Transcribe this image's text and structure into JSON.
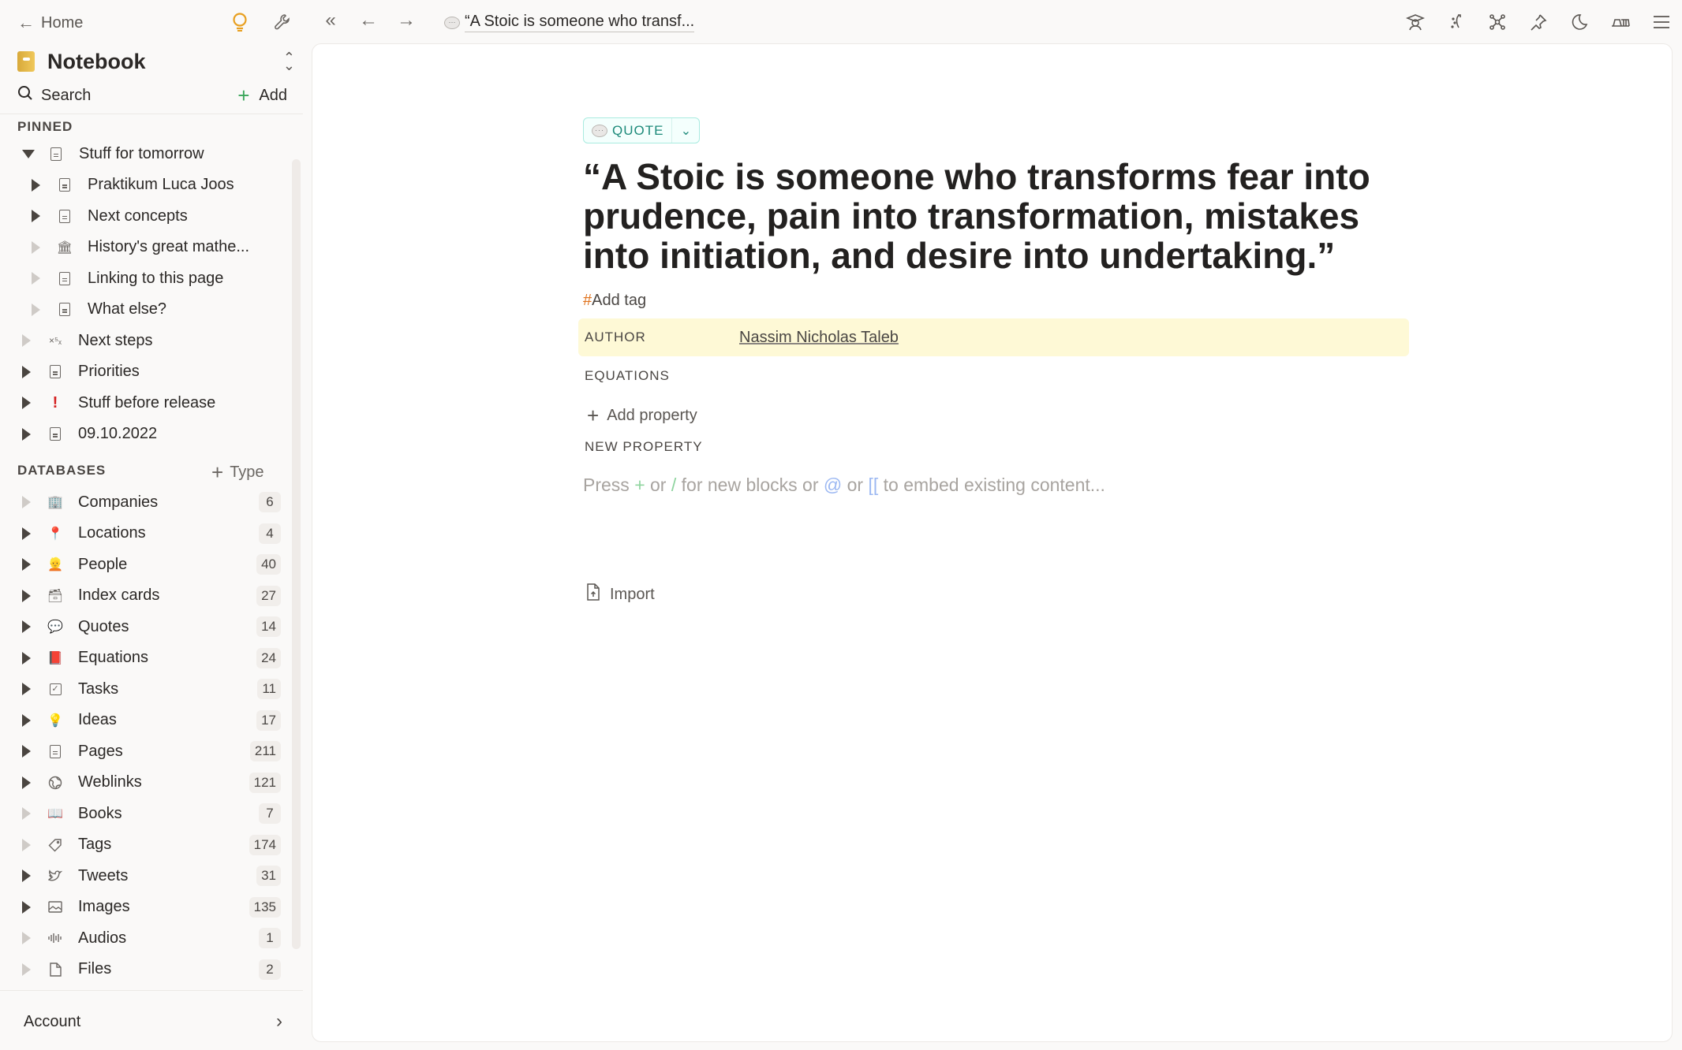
{
  "sidebar": {
    "home_label": "Home",
    "notebook_title": "Notebook",
    "search_label": "Search",
    "add_label": "Add",
    "pinned_label": "PINNED",
    "pinned_items": [
      {
        "label": "Stuff for tomorrow",
        "icon": "doc-icon",
        "expanded": true,
        "level": 0,
        "has_children": true
      },
      {
        "label": "Praktikum Luca Joos",
        "icon": "doc-icon",
        "level": 1,
        "has_children": true
      },
      {
        "label": "Next concepts",
        "icon": "doc-icon",
        "level": 1,
        "has_children": true
      },
      {
        "label": "History's great mathe...",
        "icon": "classical-building-icon",
        "level": 1,
        "has_children": false
      },
      {
        "label": "Linking to this page",
        "icon": "doc-icon",
        "level": 1,
        "has_children": false
      },
      {
        "label": "What else?",
        "icon": "doc-icon",
        "level": 1,
        "has_children": false
      },
      {
        "label": "Next steps",
        "icon": "strategy-icon",
        "level": 0,
        "has_children": false
      },
      {
        "label": "Priorities",
        "icon": "doc-icon",
        "level": 0,
        "has_children": true
      },
      {
        "label": "Stuff before release",
        "icon": "exclamation-icon",
        "level": 0,
        "has_children": true
      },
      {
        "label": "09.10.2022",
        "icon": "doc-icon",
        "level": 0,
        "has_children": true
      }
    ],
    "databases_label": "DATABASES",
    "type_label": "Type",
    "databases": [
      {
        "label": "Companies",
        "icon": "office-building-icon",
        "count": "6",
        "has_children": false
      },
      {
        "label": "Locations",
        "icon": "pin-icon",
        "count": "4",
        "has_children": true
      },
      {
        "label": "People",
        "icon": "person-icon",
        "count": "40",
        "has_children": true
      },
      {
        "label": "Index cards",
        "icon": "card-file-icon",
        "count": "27",
        "has_children": true
      },
      {
        "label": "Quotes",
        "icon": "speech-bubble-icon",
        "count": "14",
        "has_children": true
      },
      {
        "label": "Equations",
        "icon": "red-book-icon",
        "count": "24",
        "has_children": true
      },
      {
        "label": "Tasks",
        "icon": "checkbox-icon",
        "count": "11",
        "has_children": true
      },
      {
        "label": "Ideas",
        "icon": "lightbulb-icon",
        "count": "17",
        "has_children": true
      },
      {
        "label": "Pages",
        "icon": "doc-icon",
        "count": "211",
        "has_children": true
      },
      {
        "label": "Weblinks",
        "icon": "globe-icon",
        "count": "121",
        "has_children": true
      },
      {
        "label": "Books",
        "icon": "open-book-icon",
        "count": "7",
        "has_children": false
      },
      {
        "label": "Tags",
        "icon": "tag-icon",
        "count": "174",
        "has_children": false
      },
      {
        "label": "Tweets",
        "icon": "bird-icon",
        "count": "31",
        "has_children": true
      },
      {
        "label": "Images",
        "icon": "image-icon",
        "count": "135",
        "has_children": true
      },
      {
        "label": "Audios",
        "icon": "waveform-icon",
        "count": "1",
        "has_children": false
      },
      {
        "label": "Files",
        "icon": "file-icon",
        "count": "2",
        "has_children": false
      }
    ],
    "account_label": "Account"
  },
  "topbar": {
    "breadcrumb": "“A Stoic is someone who transf...",
    "right_icons": [
      "graduation-cap-icon",
      "sparkle-moon-icon",
      "graph-icon",
      "pin-icon",
      "moon-icon",
      "shelf-icon",
      "menu-icon"
    ]
  },
  "page": {
    "type_label": "QUOTE",
    "title": "“A Stoic is someone who transforms fear into prudence, pain into transformation, mistakes into initiation, and desire into undertaking.”",
    "add_tag": "Add tag",
    "properties": [
      {
        "label": "AUTHOR",
        "value": "Nassim Nicholas Taleb"
      },
      {
        "label": "EQUATIONS",
        "value": ""
      }
    ],
    "add_property": "Add property",
    "new_property": "NEW PROPERTY",
    "hint": {
      "p1": "Press ",
      "plus": "+",
      "p2": " or ",
      "slash": "/",
      "p3": " for new blocks or ",
      "at": "@",
      "p4": " or ",
      "brackets": "[[",
      "p5": " to embed existing content..."
    },
    "import_label": "Import"
  },
  "colors": {
    "accent_green": "#3aa65a",
    "quote_teal": "#1d8a7a",
    "author_highlight": "#fef9d6",
    "tag_hash": "#e0731e",
    "lightbulb_active": "#e8a021"
  }
}
